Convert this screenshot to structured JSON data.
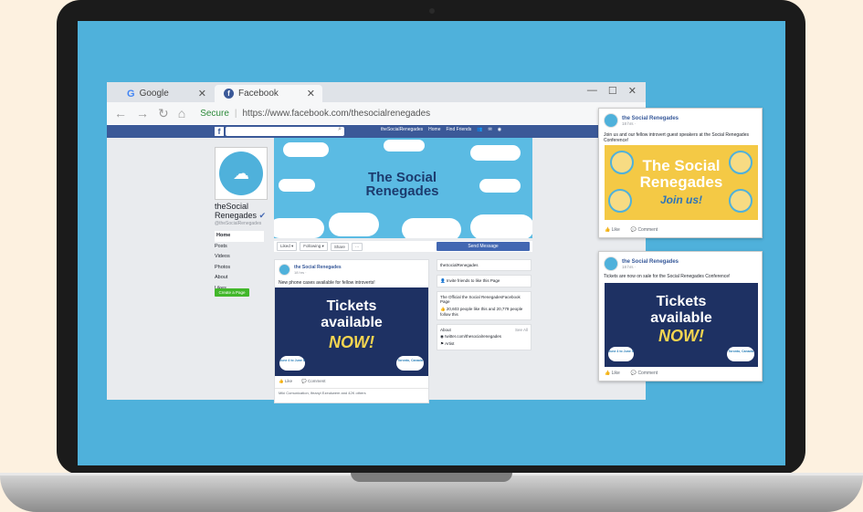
{
  "browser": {
    "tabs": [
      {
        "label": "Google",
        "icon": "google-icon"
      },
      {
        "label": "Facebook",
        "icon": "facebook-icon"
      }
    ],
    "secure_label": "Secure",
    "url": "https://www.facebook.com/thesocialrenegades",
    "window_controls": [
      "—",
      "☐",
      "✕"
    ]
  },
  "fb": {
    "topbar_links": [
      "theSocialRenegades",
      "Home",
      "Find Friends"
    ],
    "page_name_line1": "theSocial",
    "page_name_line2": "Renegades",
    "handle": "@theSocialRenegades",
    "menu": [
      "Home",
      "Posts",
      "Videos",
      "Photos",
      "About",
      "Likes"
    ],
    "create_page": "Create a Page",
    "cover_title_1": "The Social",
    "cover_title_2": "Renegades",
    "actions": [
      "Liked ▾",
      "Following ▾",
      "Share",
      "···"
    ],
    "send_message": "Send Message",
    "post": {
      "author": "the Social Renegades",
      "time": "18 hrs · ",
      "text": "New phone cases available for fellow introverts!",
      "img_line1": "Tickets",
      "img_line2": "available",
      "img_line3": "NOW!",
      "badge_left": "June 4 to June 5",
      "badge_right": "Toronto, Canada",
      "like": "Like",
      "comment": "Comment",
      "reactions": "Miki Comunication, Ifeanyi Ezeukwem and 42K others"
    },
    "right": {
      "page_label": "theSocialRenegades",
      "invite": "Invite friends to like this Page",
      "official": "The Official the Social RenegadesFacebook Page",
      "likes": "20,603 people like this and 20,779 people follow this",
      "about": "About",
      "see_all": "See All",
      "twitter": "twitter.com/thesocialrenegades",
      "artist": "Artist"
    }
  },
  "card1": {
    "author": "the Social Renegades",
    "time": "18 hrs · ",
    "text": "Join us and our fellow introvert guest speakers at the Social Renegades Conference!",
    "img_title_1": "The Social",
    "img_title_2": "Renegades",
    "img_join": "Join us!",
    "like": "Like",
    "comment": "Comment"
  },
  "card2": {
    "author": "the Social Renegades",
    "time": "18 hrs · ",
    "text": "Tickets are now on sale for the Social Renegades Conference!",
    "img_line1": "Tickets",
    "img_line2": "available",
    "img_line3": "NOW!",
    "badge_left": "June 4 to June 5",
    "badge_right": "Toronto, Canada",
    "like": "Like",
    "comment": "Comment"
  },
  "colors": {
    "screen_bg": "#4fb1db",
    "facebook_blue": "#3b5998",
    "ticket_navy": "#1e3163",
    "yellow": "#f4c945"
  }
}
